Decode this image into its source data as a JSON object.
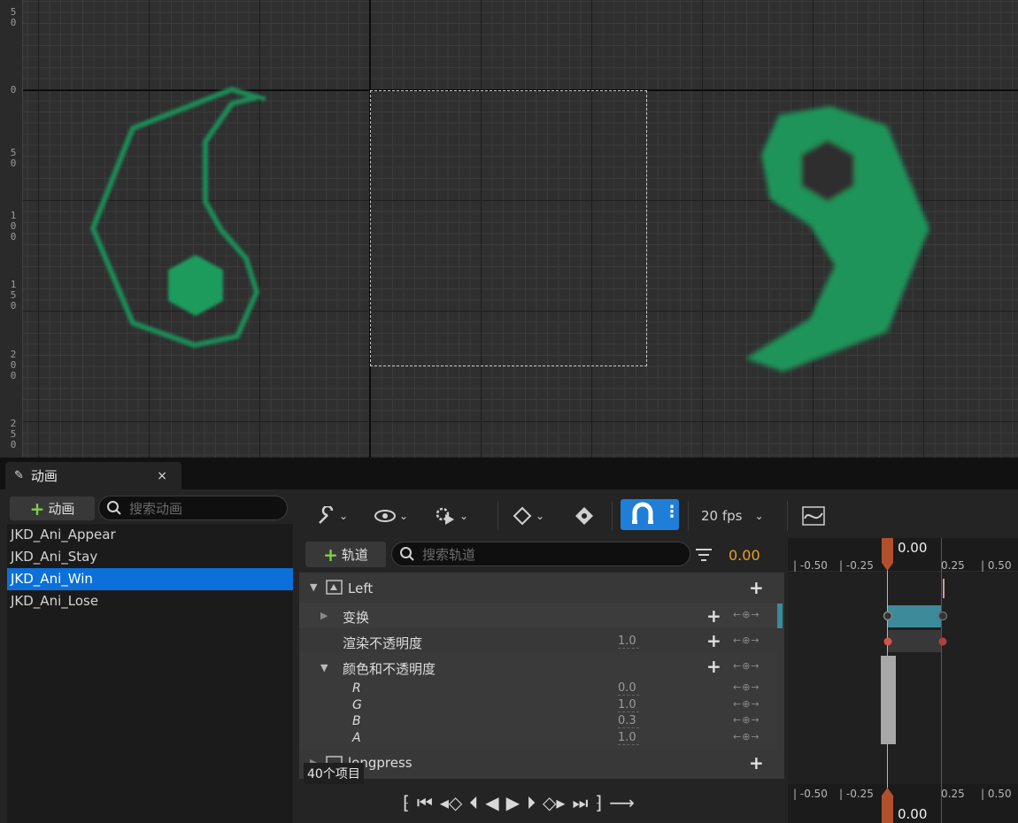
{
  "viewport": {
    "ruler_marks": [
      {
        "text": "5\n0"
      },
      {
        "text": "0"
      },
      {
        "text": "5\n0"
      },
      {
        "text": "1\n0\n0"
      },
      {
        "text": "1\n5\n0"
      },
      {
        "text": "2\n0\n0"
      },
      {
        "text": "2\n5\n0"
      }
    ]
  },
  "tab": {
    "title": "动画",
    "close": "×"
  },
  "animations": {
    "add_label": "动画",
    "search_placeholder": "搜索动画",
    "items": [
      "JKD_Ani_Appear",
      "JKD_Ani_Stay",
      "JKD_Ani_Win",
      "JKD_Ani_Lose"
    ],
    "selected_index": 2,
    "count_label": "40个项目"
  },
  "toolbar": {
    "fps_label": "20 fps",
    "colors": {
      "magnet_active": "#1f7ed7"
    }
  },
  "tracks": {
    "add_label": "轨道",
    "search_placeholder": "搜索轨道",
    "current_time": "0.00",
    "rows": [
      {
        "label": "Left",
        "kind": "widget"
      },
      {
        "label": "变换",
        "kind": "property"
      },
      {
        "label": "渲染不透明度",
        "value": "1.0"
      },
      {
        "label": "颜色和不透明度",
        "kind": "group"
      },
      {
        "label": "R",
        "value": "0.0"
      },
      {
        "label": "G",
        "value": "1.0"
      },
      {
        "label": "B",
        "value": "0.3"
      },
      {
        "label": "A",
        "value": "1.0"
      },
      {
        "label": "longpress",
        "kind": "widget"
      }
    ]
  },
  "timeline": {
    "ticks": [
      "-0.50",
      "-0.25",
      "0.25",
      "0.50"
    ],
    "playhead_top": "0.00",
    "playhead_bottom": "0.00",
    "colors": {
      "transform_bar": "#3c8b9b",
      "playhead": "#b2502e",
      "end_marker": "#c22a2a"
    }
  }
}
